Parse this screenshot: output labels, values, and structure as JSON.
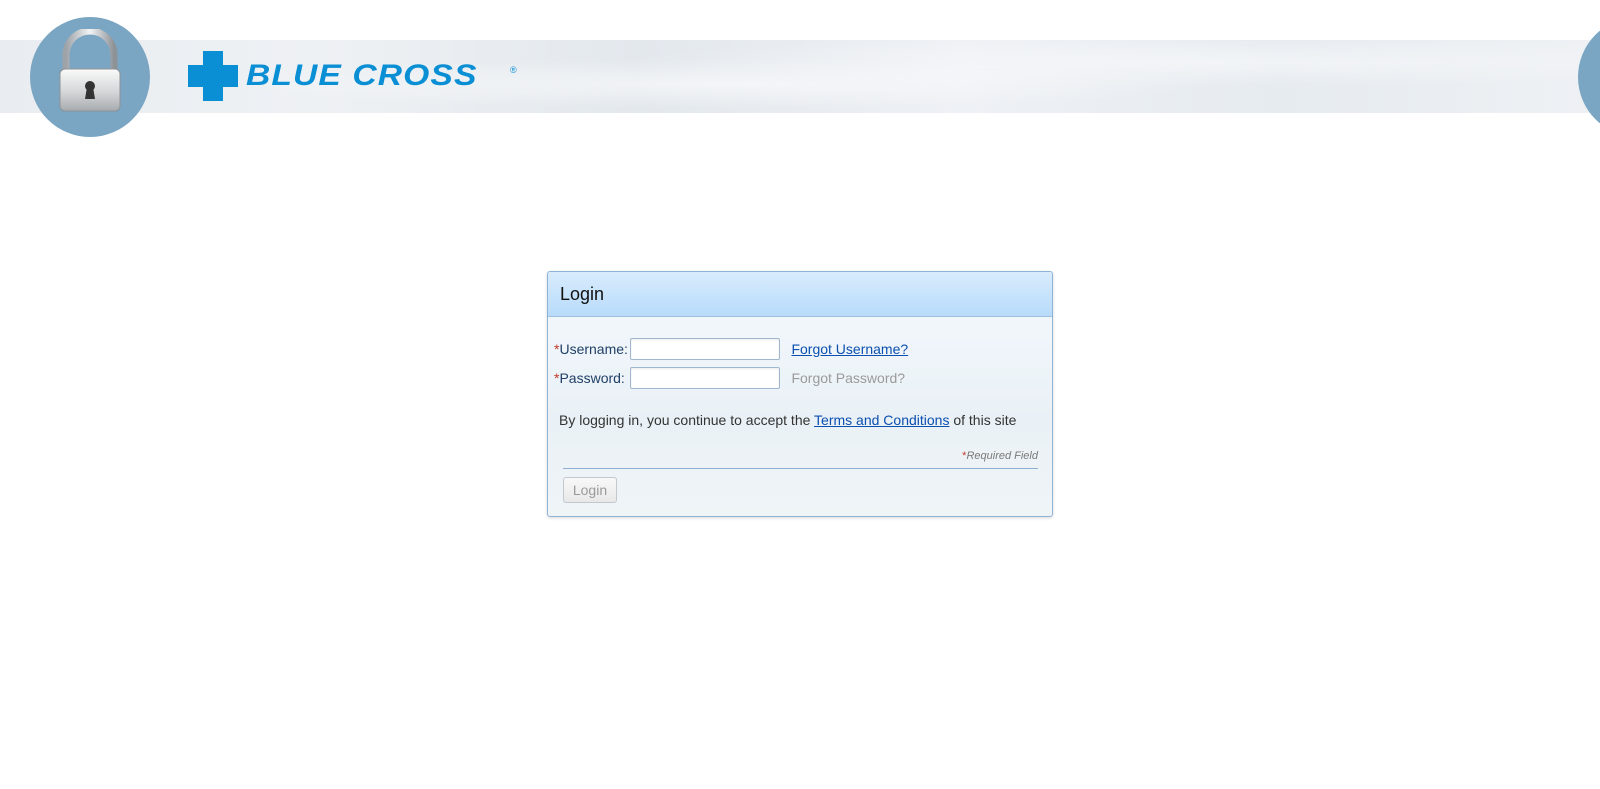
{
  "brand": {
    "logo_text": "BLUE CROSS",
    "registered_mark": "®",
    "color": "#0a8fd4"
  },
  "header": {
    "lock_icon": "padlock-icon"
  },
  "login": {
    "title": "Login",
    "required_marker": "*",
    "username_label": "Username:",
    "username_value": "",
    "password_label": "Password:",
    "password_value": "",
    "forgot_username": "Forgot Username?",
    "forgot_password": "Forgot Password?",
    "terms_prefix": "By logging in, you continue to accept the",
    "terms_link": "Terms and Conditions",
    "terms_suffix": "of this site",
    "required_field_note": "Required Field",
    "login_button": "Login"
  }
}
